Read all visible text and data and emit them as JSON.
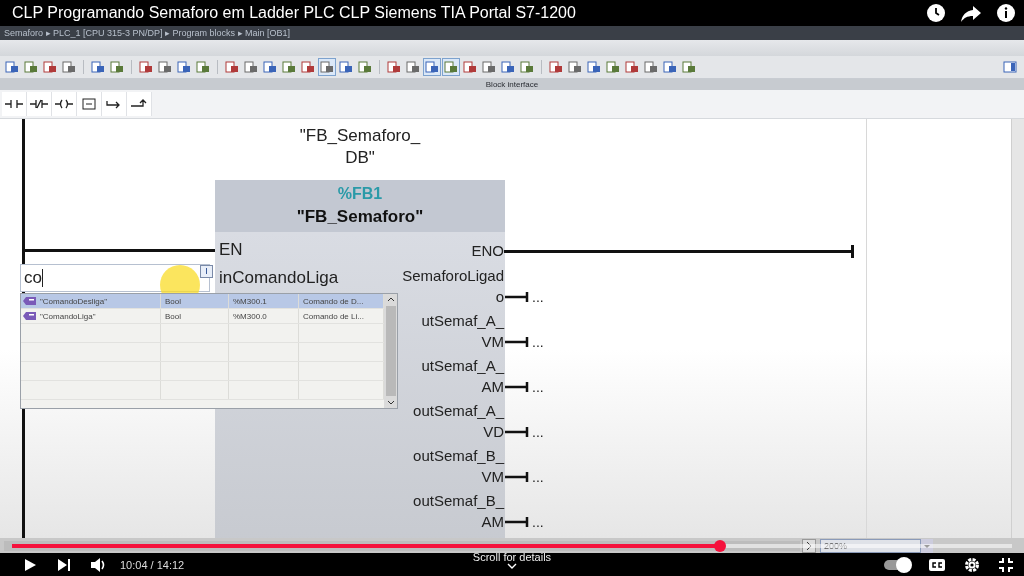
{
  "video": {
    "title": "CLP Programando Semaforo em Ladder PLC CLP Siemens TIA Portal S7-1200",
    "time": "10:04 / 14:12",
    "progress": {
      "level": 0.708
    },
    "hint": "Scroll for details",
    "autoplay": {
      "on": true
    }
  },
  "editor": {
    "breadcrumb": "Semaforo ▸ PLC_1 [CPU 315-3 PN/DP] ▸ Program blocks ▸ Main [OB1]",
    "panel_label": "Block interface",
    "zoom": "200%",
    "instance_db": "\"FB_Semaforo_DB\"",
    "block": {
      "address": "%FB1",
      "name": "\"FB_Semaforo\"",
      "inputs": [
        {
          "label": "EN"
        },
        {
          "label": "inComandoLiga"
        }
      ],
      "outputs": [
        {
          "label_lines": [
            "ENO"
          ],
          "kind": "rung"
        },
        {
          "label_lines": [
            "SemaforoLigad",
            "o"
          ],
          "kind": "pin",
          "value": "..."
        },
        {
          "label_lines": [
            "utSemaf_A_",
            "VM"
          ],
          "kind": "pin",
          "value": "..."
        },
        {
          "label_lines": [
            "utSemaf_A_",
            "AM"
          ],
          "kind": "pin",
          "value": "..."
        },
        {
          "label_lines": [
            "outSemaf_A_",
            "VD"
          ],
          "kind": "pin",
          "value": "..."
        },
        {
          "label_lines": [
            "outSemaf_B_",
            "VM"
          ],
          "kind": "pin",
          "value": "..."
        },
        {
          "label_lines": [
            "outSemaf_B_",
            "AM"
          ],
          "kind": "pin",
          "value": "..."
        }
      ]
    },
    "operand_field": {
      "value": "co"
    },
    "suggestions": [
      {
        "name": "\"ComandoDesliga\"",
        "type": "Bool",
        "address": "%M300.1",
        "comment": "Comando de D...",
        "selected": true
      },
      {
        "name": "\"ComandoLiga\"",
        "type": "Bool",
        "address": "%M300.0",
        "comment": "Comando de Li...",
        "selected": false
      }
    ]
  }
}
